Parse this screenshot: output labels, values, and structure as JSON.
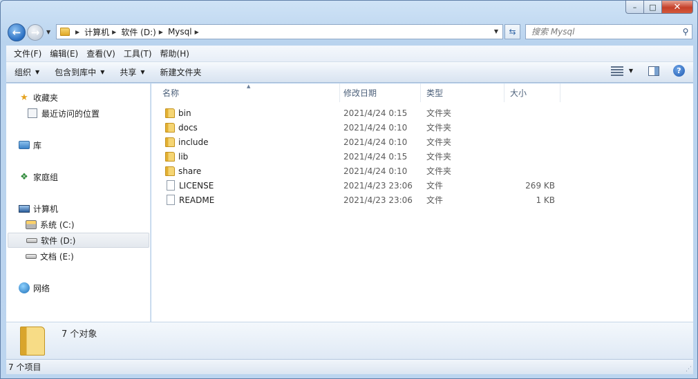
{
  "window": {
    "caption_buttons": {
      "minimize": "–",
      "maximize": "□",
      "close": "✕"
    }
  },
  "address": {
    "crumbs": [
      "计算机",
      "软件 (D:)",
      "Mysql"
    ]
  },
  "search": {
    "placeholder": "搜索 Mysql"
  },
  "menu": [
    "文件(F)",
    "编辑(E)",
    "查看(V)",
    "工具(T)",
    "帮助(H)"
  ],
  "toolbar": {
    "organize": "组织",
    "include_in_library": "包含到库中",
    "share": "共享",
    "new_folder": "新建文件夹"
  },
  "nav": {
    "favorites": "收藏夹",
    "recent": "最近访问的位置",
    "libraries": "库",
    "homegroup": "家庭组",
    "computer": "计算机",
    "drive_c": "系统 (C:)",
    "drive_d": "软件 (D:)",
    "drive_e": "文档 (E:)",
    "network": "网络"
  },
  "columns": {
    "name": "名称",
    "date": "修改日期",
    "type": "类型",
    "size": "大小"
  },
  "files": [
    {
      "name": "bin",
      "date": "2021/4/24 0:15",
      "type": "文件夹",
      "size": "",
      "kind": "folder"
    },
    {
      "name": "docs",
      "date": "2021/4/24 0:10",
      "type": "文件夹",
      "size": "",
      "kind": "folder"
    },
    {
      "name": "include",
      "date": "2021/4/24 0:10",
      "type": "文件夹",
      "size": "",
      "kind": "folder"
    },
    {
      "name": "lib",
      "date": "2021/4/24 0:15",
      "type": "文件夹",
      "size": "",
      "kind": "folder"
    },
    {
      "name": "share",
      "date": "2021/4/24 0:10",
      "type": "文件夹",
      "size": "",
      "kind": "folder"
    },
    {
      "name": "LICENSE",
      "date": "2021/4/23 23:06",
      "type": "文件",
      "size": "269 KB",
      "kind": "file"
    },
    {
      "name": "README",
      "date": "2021/4/23 23:06",
      "type": "文件",
      "size": "1 KB",
      "kind": "file"
    }
  ],
  "details": {
    "object_count": "7 个对象"
  },
  "status": {
    "item_count": "7 个项目"
  }
}
